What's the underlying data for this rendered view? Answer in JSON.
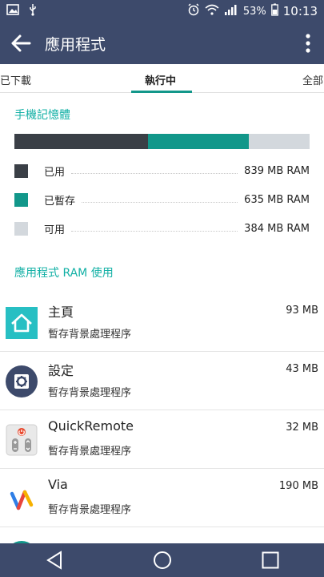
{
  "status_bar": {
    "battery": "53%",
    "time": "10:13",
    "icons": [
      "image-icon",
      "usb-icon",
      "alarm-icon",
      "wifi-icon",
      "signal-icon",
      "battery-icon"
    ]
  },
  "app_bar": {
    "title": "應用程式"
  },
  "tabs": [
    {
      "label": "已下載"
    },
    {
      "label": "執行中",
      "active": true
    },
    {
      "label": "全部"
    }
  ],
  "memory": {
    "title": "手機記憶體",
    "used": {
      "label": "已用",
      "value": "839 MB RAM",
      "mb": 839,
      "color": "#3a3f46"
    },
    "cached": {
      "label": "已暫存",
      "value": "635 MB RAM",
      "mb": 635,
      "color": "#12978a"
    },
    "free": {
      "label": "可用",
      "value": "384 MB RAM",
      "mb": 384,
      "color": "#d3d8dd"
    }
  },
  "ram_usage": {
    "title": "應用程式 RAM 使用",
    "apps": [
      {
        "name": "主頁",
        "status": "暫存背景處理程序",
        "size": "93 MB",
        "icon": "home-icon"
      },
      {
        "name": "設定",
        "status": "暫存背景處理程序",
        "size": "43 MB",
        "icon": "settings-icon"
      },
      {
        "name": "QuickRemote",
        "status": "暫存背景處理程序",
        "size": "32 MB",
        "icon": "remote-icon"
      },
      {
        "name": "Via",
        "status": "暫存背景處理程序",
        "size": "190 MB",
        "icon": "via-icon"
      }
    ]
  }
}
